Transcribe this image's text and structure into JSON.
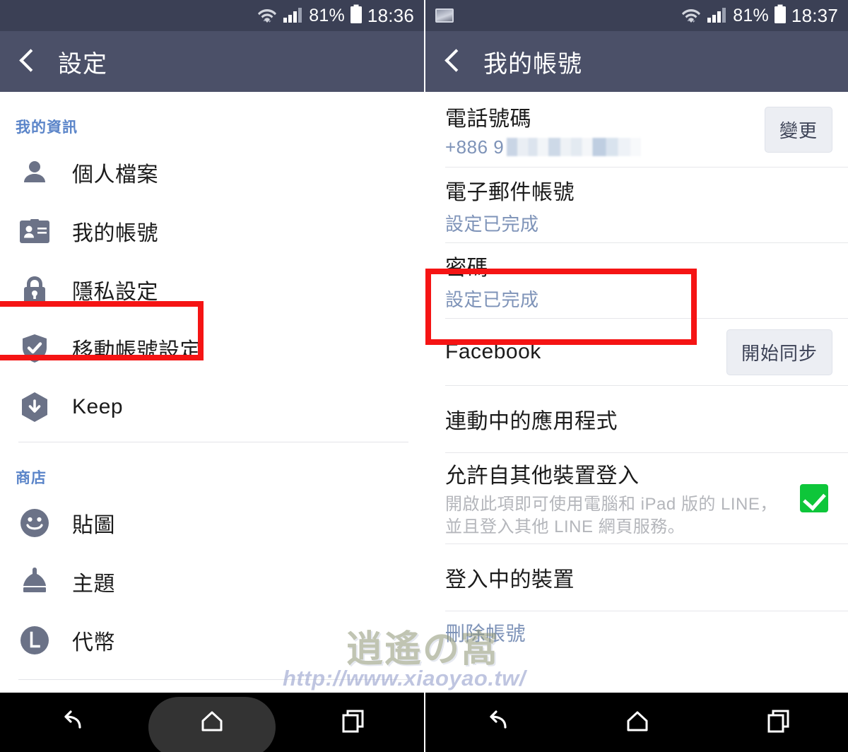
{
  "left_panel": {
    "status_bar": {
      "battery_percent": "81%",
      "time": "18:36",
      "wifi_icon": "wifi-icon",
      "signal_icon": "signal-bars-icon",
      "battery_icon": "battery-icon"
    },
    "appbar": {
      "back_icon": "back-chevron-icon",
      "title": "設定"
    },
    "sections": [
      {
        "header": "我的資訊",
        "items": [
          {
            "label": "個人檔案",
            "icon": "person-icon",
            "highlighted": false
          },
          {
            "label": "我的帳號",
            "icon": "id-card-icon",
            "highlighted": true
          },
          {
            "label": "隱私設定",
            "icon": "lock-icon",
            "highlighted": false
          },
          {
            "label": "移動帳號設定",
            "icon": "shield-check-icon",
            "highlighted": false
          },
          {
            "label": "Keep",
            "icon": "keep-hexagon-download-icon",
            "highlighted": false
          }
        ]
      },
      {
        "header": "商店",
        "items": [
          {
            "label": "貼圖",
            "icon": "smiley-face-icon",
            "highlighted": false
          },
          {
            "label": "主題",
            "icon": "brush-icon",
            "highlighted": false
          },
          {
            "label": "代幣",
            "icon": "coin-l-icon",
            "highlighted": false
          }
        ]
      }
    ]
  },
  "right_panel": {
    "status_bar": {
      "screenshot_icon": "screenshot-icon",
      "battery_percent": "81%",
      "time": "18:37",
      "wifi_icon": "wifi-icon",
      "signal_icon": "signal-bars-icon",
      "battery_icon": "battery-icon"
    },
    "appbar": {
      "back_icon": "back-chevron-icon",
      "title": "我的帳號"
    },
    "rows": [
      {
        "title": "電話號碼",
        "subtitle_prefix": "+886 9",
        "subtitle_masked": true,
        "action_label": "變更",
        "highlighted": false
      },
      {
        "title": "電子郵件帳號",
        "subtitle": "設定已完成",
        "highlighted": true
      },
      {
        "title": "密碼",
        "subtitle": "設定已完成",
        "highlighted": false
      },
      {
        "title": "Facebook",
        "action_label": "開始同步",
        "highlighted": false
      },
      {
        "title": "連動中的應用程式",
        "highlighted": false
      },
      {
        "title": "允許自其他裝置登入",
        "subtitle": "開啟此項即可使用電腦和 iPad 版的 LINE，並且登入其他 LINE 網頁服務。",
        "checkbox_checked": true,
        "highlighted": false
      },
      {
        "title": "登入中的裝置",
        "highlighted": false
      },
      {
        "title": "刪除帳號",
        "highlighted": false
      }
    ]
  },
  "watermark": {
    "logo_text": "逍遙の窩",
    "url_text": "http://www.xiaoyao.tw/"
  },
  "navbar": {
    "back_icon": "nav-back-icon",
    "home_icon": "nav-home-icon",
    "recents_icon": "nav-recents-icon"
  },
  "colors": {
    "status_bar": "#3b4055",
    "app_bar": "#4b5068",
    "section_header": "#5b85c9",
    "sub_link": "#7e93b8",
    "annotation_red": "#f51414",
    "checkbox_green": "#0ec63a",
    "navbar": "#000000"
  }
}
